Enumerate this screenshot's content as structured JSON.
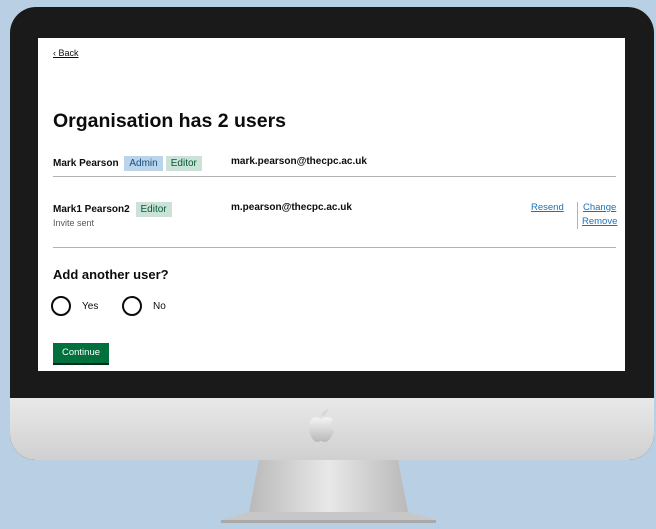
{
  "page": {
    "back_label": "Back",
    "title": "Organisation has 2 users"
  },
  "users": [
    {
      "name": "Mark Pearson",
      "tags": [
        "Admin",
        "Editor"
      ],
      "email": "mark.pearson@thecpc.ac.uk"
    },
    {
      "name": "Mark1 Pearson2",
      "tags": [
        "Editor"
      ],
      "email": "m.pearson@thecpc.ac.uk",
      "status": "Invite sent",
      "actions": {
        "resend": "Resend",
        "change": "Change",
        "remove": "Remove"
      }
    }
  ],
  "add_user": {
    "question": "Add another user?",
    "options": [
      "Yes",
      "No"
    ]
  },
  "continue_label": "Continue",
  "colors": {
    "admin_tag_bg": "#bbd4ea",
    "editor_tag_bg": "#cce2d8",
    "button_green": "#00703c",
    "link_blue": "#1d70b8",
    "background": "#b9cfe3"
  },
  "icons": [
    "apple-logo-icon"
  ]
}
